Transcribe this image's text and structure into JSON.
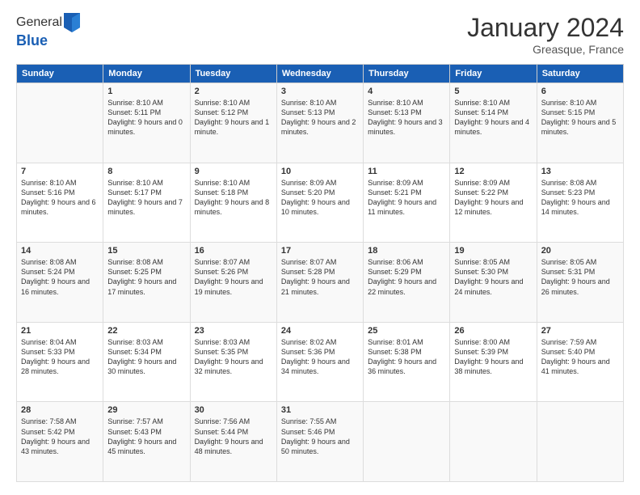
{
  "logo": {
    "general": "General",
    "blue": "Blue"
  },
  "title": "January 2024",
  "location": "Greasque, France",
  "days_of_week": [
    "Sunday",
    "Monday",
    "Tuesday",
    "Wednesday",
    "Thursday",
    "Friday",
    "Saturday"
  ],
  "weeks": [
    [
      {
        "day": "",
        "sunrise": "",
        "sunset": "",
        "daylight": ""
      },
      {
        "day": "1",
        "sunrise": "Sunrise: 8:10 AM",
        "sunset": "Sunset: 5:11 PM",
        "daylight": "Daylight: 9 hours and 0 minutes."
      },
      {
        "day": "2",
        "sunrise": "Sunrise: 8:10 AM",
        "sunset": "Sunset: 5:12 PM",
        "daylight": "Daylight: 9 hours and 1 minute."
      },
      {
        "day": "3",
        "sunrise": "Sunrise: 8:10 AM",
        "sunset": "Sunset: 5:13 PM",
        "daylight": "Daylight: 9 hours and 2 minutes."
      },
      {
        "day": "4",
        "sunrise": "Sunrise: 8:10 AM",
        "sunset": "Sunset: 5:13 PM",
        "daylight": "Daylight: 9 hours and 3 minutes."
      },
      {
        "day": "5",
        "sunrise": "Sunrise: 8:10 AM",
        "sunset": "Sunset: 5:14 PM",
        "daylight": "Daylight: 9 hours and 4 minutes."
      },
      {
        "day": "6",
        "sunrise": "Sunrise: 8:10 AM",
        "sunset": "Sunset: 5:15 PM",
        "daylight": "Daylight: 9 hours and 5 minutes."
      }
    ],
    [
      {
        "day": "7",
        "sunrise": "Sunrise: 8:10 AM",
        "sunset": "Sunset: 5:16 PM",
        "daylight": "Daylight: 9 hours and 6 minutes."
      },
      {
        "day": "8",
        "sunrise": "Sunrise: 8:10 AM",
        "sunset": "Sunset: 5:17 PM",
        "daylight": "Daylight: 9 hours and 7 minutes."
      },
      {
        "day": "9",
        "sunrise": "Sunrise: 8:10 AM",
        "sunset": "Sunset: 5:18 PM",
        "daylight": "Daylight: 9 hours and 8 minutes."
      },
      {
        "day": "10",
        "sunrise": "Sunrise: 8:09 AM",
        "sunset": "Sunset: 5:20 PM",
        "daylight": "Daylight: 9 hours and 10 minutes."
      },
      {
        "day": "11",
        "sunrise": "Sunrise: 8:09 AM",
        "sunset": "Sunset: 5:21 PM",
        "daylight": "Daylight: 9 hours and 11 minutes."
      },
      {
        "day": "12",
        "sunrise": "Sunrise: 8:09 AM",
        "sunset": "Sunset: 5:22 PM",
        "daylight": "Daylight: 9 hours and 12 minutes."
      },
      {
        "day": "13",
        "sunrise": "Sunrise: 8:08 AM",
        "sunset": "Sunset: 5:23 PM",
        "daylight": "Daylight: 9 hours and 14 minutes."
      }
    ],
    [
      {
        "day": "14",
        "sunrise": "Sunrise: 8:08 AM",
        "sunset": "Sunset: 5:24 PM",
        "daylight": "Daylight: 9 hours and 16 minutes."
      },
      {
        "day": "15",
        "sunrise": "Sunrise: 8:08 AM",
        "sunset": "Sunset: 5:25 PM",
        "daylight": "Daylight: 9 hours and 17 minutes."
      },
      {
        "day": "16",
        "sunrise": "Sunrise: 8:07 AM",
        "sunset": "Sunset: 5:26 PM",
        "daylight": "Daylight: 9 hours and 19 minutes."
      },
      {
        "day": "17",
        "sunrise": "Sunrise: 8:07 AM",
        "sunset": "Sunset: 5:28 PM",
        "daylight": "Daylight: 9 hours and 21 minutes."
      },
      {
        "day": "18",
        "sunrise": "Sunrise: 8:06 AM",
        "sunset": "Sunset: 5:29 PM",
        "daylight": "Daylight: 9 hours and 22 minutes."
      },
      {
        "day": "19",
        "sunrise": "Sunrise: 8:05 AM",
        "sunset": "Sunset: 5:30 PM",
        "daylight": "Daylight: 9 hours and 24 minutes."
      },
      {
        "day": "20",
        "sunrise": "Sunrise: 8:05 AM",
        "sunset": "Sunset: 5:31 PM",
        "daylight": "Daylight: 9 hours and 26 minutes."
      }
    ],
    [
      {
        "day": "21",
        "sunrise": "Sunrise: 8:04 AM",
        "sunset": "Sunset: 5:33 PM",
        "daylight": "Daylight: 9 hours and 28 minutes."
      },
      {
        "day": "22",
        "sunrise": "Sunrise: 8:03 AM",
        "sunset": "Sunset: 5:34 PM",
        "daylight": "Daylight: 9 hours and 30 minutes."
      },
      {
        "day": "23",
        "sunrise": "Sunrise: 8:03 AM",
        "sunset": "Sunset: 5:35 PM",
        "daylight": "Daylight: 9 hours and 32 minutes."
      },
      {
        "day": "24",
        "sunrise": "Sunrise: 8:02 AM",
        "sunset": "Sunset: 5:36 PM",
        "daylight": "Daylight: 9 hours and 34 minutes."
      },
      {
        "day": "25",
        "sunrise": "Sunrise: 8:01 AM",
        "sunset": "Sunset: 5:38 PM",
        "daylight": "Daylight: 9 hours and 36 minutes."
      },
      {
        "day": "26",
        "sunrise": "Sunrise: 8:00 AM",
        "sunset": "Sunset: 5:39 PM",
        "daylight": "Daylight: 9 hours and 38 minutes."
      },
      {
        "day": "27",
        "sunrise": "Sunrise: 7:59 AM",
        "sunset": "Sunset: 5:40 PM",
        "daylight": "Daylight: 9 hours and 41 minutes."
      }
    ],
    [
      {
        "day": "28",
        "sunrise": "Sunrise: 7:58 AM",
        "sunset": "Sunset: 5:42 PM",
        "daylight": "Daylight: 9 hours and 43 minutes."
      },
      {
        "day": "29",
        "sunrise": "Sunrise: 7:57 AM",
        "sunset": "Sunset: 5:43 PM",
        "daylight": "Daylight: 9 hours and 45 minutes."
      },
      {
        "day": "30",
        "sunrise": "Sunrise: 7:56 AM",
        "sunset": "Sunset: 5:44 PM",
        "daylight": "Daylight: 9 hours and 48 minutes."
      },
      {
        "day": "31",
        "sunrise": "Sunrise: 7:55 AM",
        "sunset": "Sunset: 5:46 PM",
        "daylight": "Daylight: 9 hours and 50 minutes."
      },
      {
        "day": "",
        "sunrise": "",
        "sunset": "",
        "daylight": ""
      },
      {
        "day": "",
        "sunrise": "",
        "sunset": "",
        "daylight": ""
      },
      {
        "day": "",
        "sunrise": "",
        "sunset": "",
        "daylight": ""
      }
    ]
  ]
}
